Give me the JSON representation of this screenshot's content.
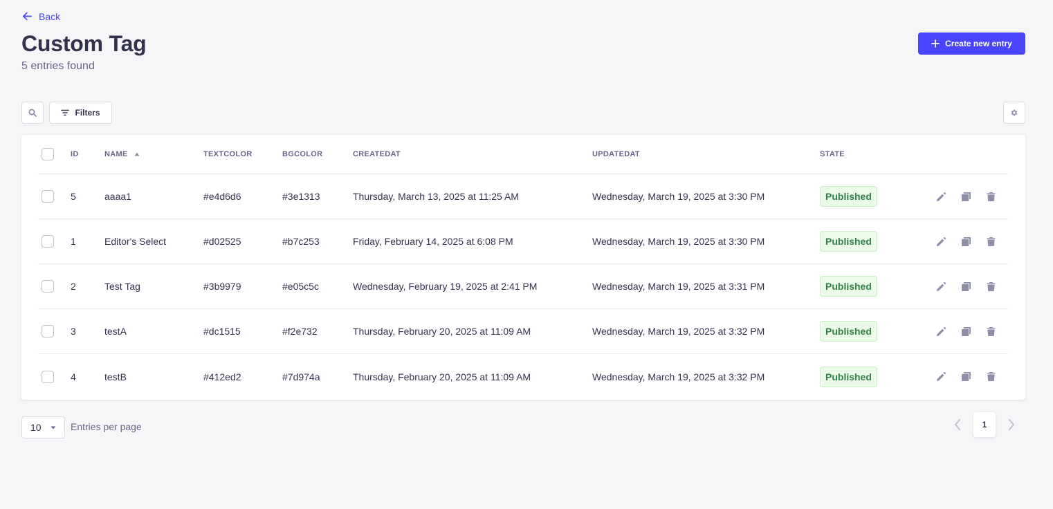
{
  "header": {
    "back_label": "Back",
    "title": "Custom Tag",
    "subtitle": "5 entries found",
    "create_label": "Create new entry"
  },
  "toolbar": {
    "filters_label": "Filters"
  },
  "table": {
    "columns": {
      "id": "ID",
      "name": "NAME",
      "textcolor": "TEXTCOLOR",
      "bgcolor": "BGCOLOR",
      "createdat": "CREATEDAT",
      "updatedat": "UPDATEDAT",
      "state": "STATE"
    },
    "sort": {
      "column": "name",
      "direction": "ascending"
    },
    "rows": [
      {
        "id": "5",
        "name": "aaaa1",
        "textcolor": "#e4d6d6",
        "bgcolor": "#3e1313",
        "createdat": "Thursday, March 13, 2025 at 11:25 AM",
        "updatedat": "Wednesday, March 19, 2025 at 3:30 PM",
        "state": "Published"
      },
      {
        "id": "1",
        "name": "Editor's Select",
        "textcolor": "#d02525",
        "bgcolor": "#b7c253",
        "createdat": "Friday, February 14, 2025 at 6:08 PM",
        "updatedat": "Wednesday, March 19, 2025 at 3:30 PM",
        "state": "Published"
      },
      {
        "id": "2",
        "name": "Test Tag",
        "textcolor": "#3b9979",
        "bgcolor": "#e05c5c",
        "createdat": "Wednesday, February 19, 2025 at 2:41 PM",
        "updatedat": "Wednesday, March 19, 2025 at 3:31 PM",
        "state": "Published"
      },
      {
        "id": "3",
        "name": "testA",
        "textcolor": "#dc1515",
        "bgcolor": "#f2e732",
        "createdat": "Thursday, February 20, 2025 at 11:09 AM",
        "updatedat": "Wednesday, March 19, 2025 at 3:32 PM",
        "state": "Published"
      },
      {
        "id": "4",
        "name": "testB",
        "textcolor": "#412ed2",
        "bgcolor": "#7d974a",
        "createdat": "Thursday, February 20, 2025 at 11:09 AM",
        "updatedat": "Wednesday, March 19, 2025 at 3:32 PM",
        "state": "Published"
      }
    ],
    "row_actions": [
      "pencil-icon",
      "duplicate-icon",
      "trash-icon"
    ]
  },
  "pagination": {
    "per_page_value": "10",
    "per_page_label": "Entries per page",
    "current_page": "1"
  },
  "colors": {
    "primary": "#4945ff",
    "background": "#f6f6f9",
    "published_bg": "#eafbe7",
    "published_text": "#328048"
  }
}
